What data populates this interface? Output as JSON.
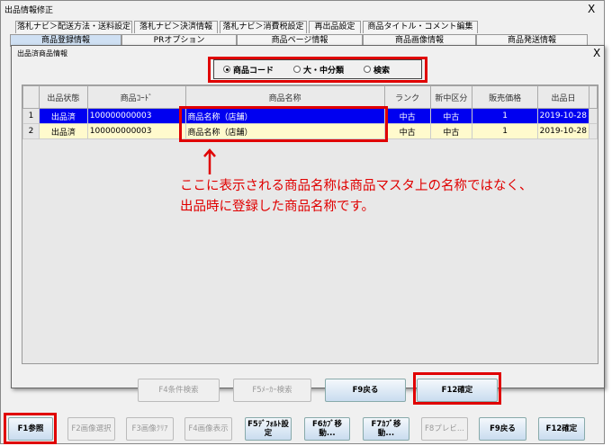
{
  "window": {
    "title": "出品情報修正",
    "close": "X"
  },
  "tabs_row1": [
    "落札ナビ＞配送方法・送料設定",
    "落札ナビ＞決済情報",
    "落札ナビ＞消費税設定",
    "再出品設定",
    "商品タイトル・コメント編集"
  ],
  "tabs_row2": [
    "商品登録情報",
    "PRオプション",
    "商品ページ情報",
    "商品画像情報",
    "商品発送情報"
  ],
  "dialog": {
    "title": "出品済商品情報",
    "close": "X",
    "radios": [
      {
        "label": "商品コード",
        "checked": true
      },
      {
        "label": "大・中分類",
        "checked": false
      },
      {
        "label": "検索",
        "checked": false
      }
    ],
    "columns": [
      "出品状態",
      "商品ｺｰﾄﾞ",
      "商品名称",
      "ランク",
      "新中区分",
      "販売価格",
      "出品日"
    ],
    "rows": [
      {
        "n": "1",
        "status": "出品済",
        "code": "100000000003",
        "name": "商品名称（店舗）",
        "rank": "中古",
        "kubun": "中古",
        "price": "1",
        "date": "2019-10-28",
        "selected": true
      },
      {
        "n": "2",
        "status": "出品済",
        "code": "100000000003",
        "name": "商品名称（店舗）",
        "rank": "中古",
        "kubun": "中古",
        "price": "1",
        "date": "2019-10-28",
        "selected": false
      }
    ],
    "buttons": [
      {
        "label": "F4条件検索",
        "enabled": false
      },
      {
        "label": "F5ﾒｰｶｰ検索",
        "enabled": false
      },
      {
        "label": "F9戻る",
        "enabled": true
      },
      {
        "label": "F12確定",
        "enabled": true
      }
    ]
  },
  "annotation": {
    "line1": "ここに表示される商品名称は商品マスタ上の名称ではなく、",
    "line2": "出品時に登録した商品名称です。",
    "color": "#e00000"
  },
  "bottom_buttons": [
    {
      "label": "F1参照",
      "enabled": true
    },
    {
      "label": "F2画像選択",
      "enabled": false
    },
    {
      "label": "F3画像ｸﾘｱ",
      "enabled": false
    },
    {
      "label": "F4画像表示",
      "enabled": false
    },
    {
      "label": "F5ﾃﾞﾌｫﾙﾄ設定",
      "enabled": true
    },
    {
      "label": "F6ｶﾌﾞ移動...",
      "enabled": true
    },
    {
      "label": "F7ｶﾌﾞ移動...",
      "enabled": true
    },
    {
      "label": "F8プレビ...",
      "enabled": false
    },
    {
      "label": "F9戻る",
      "enabled": true
    },
    {
      "label": "F12確定",
      "enabled": true
    }
  ]
}
